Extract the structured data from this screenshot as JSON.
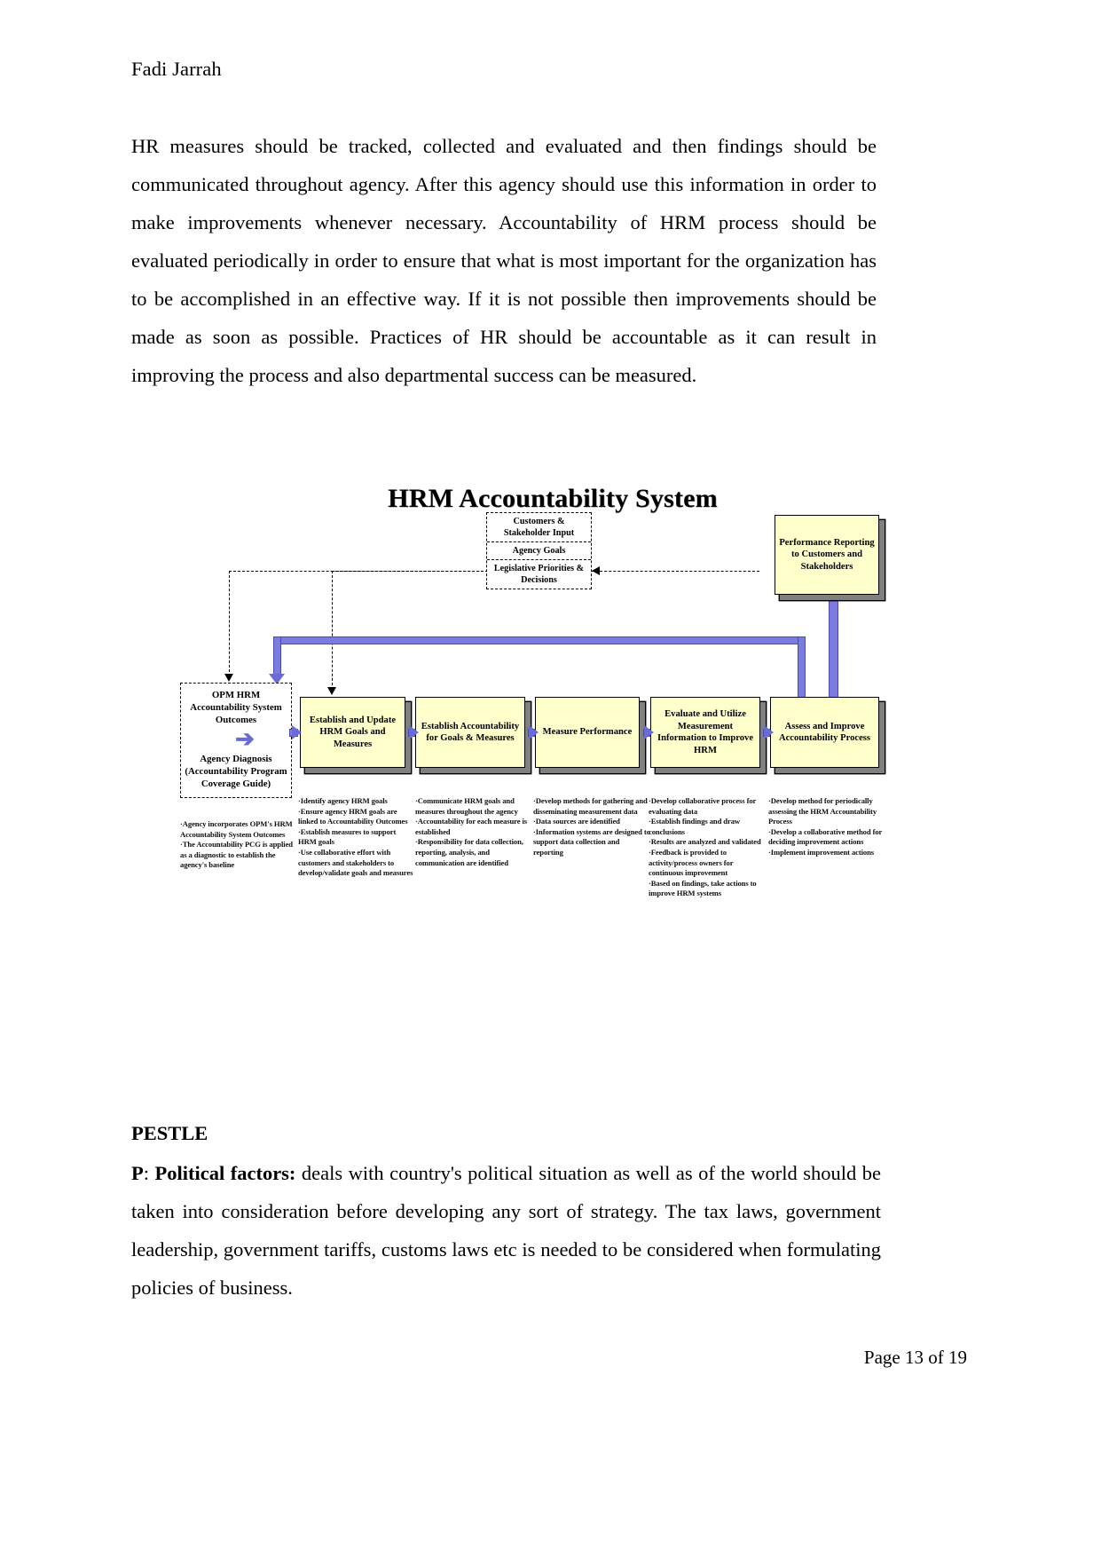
{
  "document": {
    "running_head": "Fadi Jarrah",
    "page_footer": "Page 13 of 19",
    "paragraph_1": "HR measures should be tracked, collected and evaluated and then findings should be communicated throughout agency. After this agency should use this information in order to make improvements whenever necessary. Accountability of HRM process should be evaluated periodically in order to ensure that what is most important for the organization has to be accomplished in an effective way. If it is not possible then improvements should be made as soon as possible. Practices of HR should be accountable as it can result in improving the process and also departmental success can be measured.",
    "section_heading": "PESTLE",
    "pestle_label": "P",
    "pestle_bold": "Political factors:",
    "pestle_text": " deals with country's political situation as well as of the world should be taken into consideration before developing any sort of strategy. The tax laws, government leadership, government tariffs, customs laws etc is needed to be considered when formulating policies of business."
  },
  "figure": {
    "title": "HRM Accountability System",
    "colors": {
      "box_fill": "#ffffcc",
      "box_shadow": "#808080",
      "flow_blue": "#6b6bd8",
      "outline": "#000000"
    },
    "input_stack": [
      "Customers & Stakeholder Input",
      "Agency Goals",
      "Legislative Priorities & Decisions"
    ],
    "reporting_box": "Performance Reporting to Customers and Stakeholders",
    "opm_box": {
      "title": "OPM HRM Accountability System Outcomes",
      "subtitle": "Agency Diagnosis (Accountability Program Coverage Guide)"
    },
    "opm_bullets": [
      "·Agency incorporates  OPM's HRM Accountability System Outcomes",
      "·The Accountability PCG is applied as a diagnostic to establish the agency's baseline"
    ],
    "steps": [
      {
        "title": "Establish and Update HRM Goals and Measures",
        "bullets": [
          "·Identify agency HRM goals",
          "·Ensure agency HRM goals are linked to Accountability Outcomes",
          "·Establish measures to support HRM goals",
          "·Use collaborative effort with customers and stakeholders to develop/validate goals and measures"
        ]
      },
      {
        "title": "Establish Accountability for Goals & Measures",
        "bullets": [
          "·Communicate HRM goals and measures throughout the agency",
          "·Accountability for each measure is established",
          "·Responsibility for data collection, reporting, analysis, and communication are identified"
        ]
      },
      {
        "title": "Measure Performance",
        "bullets": [
          "·Develop methods for gathering and disseminating measurement data",
          "·Data sources are identified",
          "·Information systems are designed to support data collection and reporting"
        ]
      },
      {
        "title": "Evaluate and Utilize Measurement Information to Improve HRM",
        "bullets": [
          "·Develop collaborative process for evaluating data",
          "·Establish findings and draw conclusions",
          "·Results are analyzed and validated",
          "·Feedback is provided to activity/process owners for continuous improvement",
          "·Based on findings, take actions to improve HRM systems"
        ]
      },
      {
        "title": "Assess and Improve Accountability Process",
        "bullets": [
          "·Develop method for periodically assessing the HRM Accountability Process",
          "·Develop a collaborative method for deciding improvement actions",
          "·Implement improvement actions"
        ]
      }
    ]
  }
}
